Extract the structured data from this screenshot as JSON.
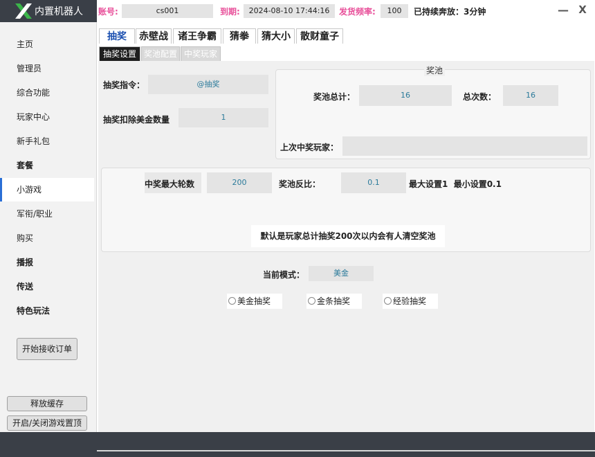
{
  "app": {
    "name": "内置机器人"
  },
  "header": {
    "account_label": "账号:",
    "account_value": "cs001",
    "expiry_label": "到期:",
    "expiry_value": "2024-08-10 17:44:16",
    "freq_label": "发货频率:",
    "freq_value": "100",
    "uptime_text": "已持续奔放：3分钟",
    "minimize": "—",
    "close": "X"
  },
  "sidebar": {
    "items": [
      {
        "label": "主页"
      },
      {
        "label": "管理员"
      },
      {
        "label": "综合功能"
      },
      {
        "label": "玩家中心"
      },
      {
        "label": "新手礼包"
      },
      {
        "label": "套餐"
      },
      {
        "label": "小游戏"
      },
      {
        "label": "军衔/职业"
      },
      {
        "label": "购买"
      },
      {
        "label": "播报"
      },
      {
        "label": "传送"
      },
      {
        "label": "特色玩法"
      }
    ],
    "active_index": 6,
    "order_button": "开始接收订单",
    "release_cache_button": "释放缓存",
    "toggle_top_button": "开启/关闭游戏置顶"
  },
  "tabs": [
    "抽奖",
    "赤壁战",
    "诸王争霸",
    "猜拳",
    "猜大小",
    "散财童子"
  ],
  "subtabs": [
    "抽奖设置",
    "奖池配置",
    "中奖玩家"
  ],
  "lottery": {
    "command_label": "抽奖指令：",
    "command_value": "@抽奖",
    "deduct_label": "抽奖扣除美金数量",
    "deduct_value": "1"
  },
  "pool": {
    "title": "奖池",
    "total_label": "奖池总计：",
    "total_value": "16",
    "count_label": "总次数：",
    "count_value": "16",
    "last_winner_label": "上次中奖玩家：",
    "last_winner_value": ""
  },
  "rounds": {
    "max_label": "中奖最大轮数",
    "max_value": "200",
    "ratio_label": "奖池反比：",
    "ratio_value": "0.1",
    "limits_text": "最大设置1  最小设置0.1",
    "note": "默认是玩家总计抽奖200次以内会有人清空奖池"
  },
  "mode": {
    "label": "当前模式：",
    "value": "美金",
    "options": [
      "美金抽奖",
      "金条抽奖",
      "经验抽奖"
    ]
  },
  "colors": {
    "accent_pink": "#e8509a",
    "dark_chrome": "#3a3f47",
    "value_text": "#2a7a9a",
    "logo_green": "#3bb54a"
  }
}
